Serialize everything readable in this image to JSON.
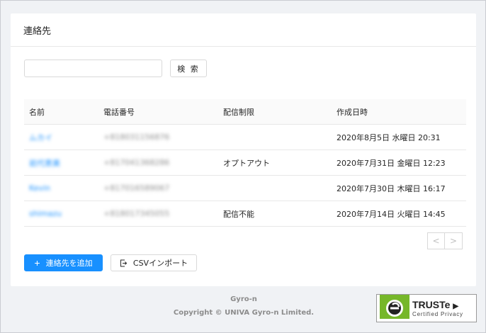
{
  "card": {
    "title": "連絡先"
  },
  "search": {
    "value": "",
    "placeholder": "",
    "button_label": "検 索"
  },
  "table": {
    "columns": [
      "名前",
      "電話番号",
      "配信制限",
      "作成日時"
    ],
    "rows": [
      {
        "name": "ムカイ",
        "phone": "+818031156876",
        "restriction": "",
        "created": "2020年8月5日 水曜日 20:31"
      },
      {
        "name": "岩代恵美",
        "phone": "+817041368286",
        "restriction": "オプトアウト",
        "created": "2020年7月31日 金曜日 12:23"
      },
      {
        "name": "Kevin",
        "phone": "+817016589067",
        "restriction": "",
        "created": "2020年7月30日 木曜日 16:17"
      },
      {
        "name": "shimazu",
        "phone": "+818017345055",
        "restriction": "配信不能",
        "created": "2020年7月14日 火曜日 14:45"
      }
    ]
  },
  "pagination": {
    "prev": "<",
    "next": ">"
  },
  "actions": {
    "add_label": "連絡先を追加",
    "csv_label": "CSVインポート"
  },
  "footer": {
    "brand": "Gyro-n",
    "copyright": "Copyright © UNIVA Gyro-n Limited."
  },
  "truste": {
    "title": "TRUSTe",
    "subtitle": "Certified Privacy"
  },
  "icons": {
    "add": "plus-icon",
    "import": "import-icon",
    "prev": "chevron-left-icon",
    "next": "chevron-right-icon"
  },
  "colors": {
    "primary": "#1890ff",
    "background": "#f0f2f5",
    "truste_green": "#76b72a"
  }
}
